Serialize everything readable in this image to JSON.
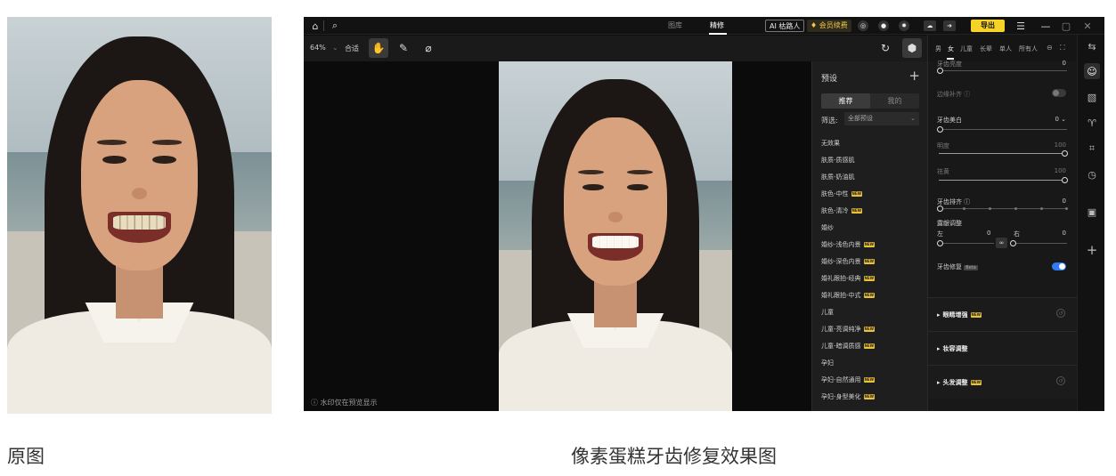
{
  "captions": {
    "left": "原图",
    "right": "像素蛋糕牙齿修复效果图"
  },
  "topbar": {
    "tabs": [
      "图库",
      "精修"
    ],
    "active_tab": "精修",
    "ai_label": "AI 枯路人",
    "member_label": "会员续费",
    "export_label": "导出",
    "icons": [
      "home-icon",
      "search-icon",
      "headset-icon",
      "user-icon",
      "settings-icon",
      "cloud-icon",
      "arrow-icon",
      "menu-icon",
      "minimize-icon",
      "maximize-icon",
      "close-icon"
    ],
    "accent": "#f5d427"
  },
  "toolbar": {
    "zoom": "64%",
    "fit_label": "合适",
    "icons": [
      "hand-icon",
      "brush-icon",
      "eraser-icon",
      "rotate-icon",
      "cube-icon"
    ]
  },
  "canvas": {
    "watermark_note": "水印仅在预览显示"
  },
  "preset_panel": {
    "title": "预设",
    "segments": [
      "推荐",
      "我的"
    ],
    "active_segment": "推荐",
    "filter_label": "筛选:",
    "filter_value": "全部预设",
    "items": [
      {
        "label": "无效果",
        "new": false
      },
      {
        "label": "肤质-质感肌",
        "new": false
      },
      {
        "label": "肤质-奶油肌",
        "new": false
      },
      {
        "label": "肤色-中性",
        "new": true
      },
      {
        "label": "肤色-清冷",
        "new": true
      },
      {
        "label": "婚纱",
        "new": false
      },
      {
        "label": "婚纱-浅色内景",
        "new": true
      },
      {
        "label": "婚纱-深色内景",
        "new": true
      },
      {
        "label": "婚礼跟拍-经典",
        "new": true
      },
      {
        "label": "婚礼跟拍-中式",
        "new": true
      },
      {
        "label": "儿童",
        "new": false
      },
      {
        "label": "儿童-亮调纯净",
        "new": true
      },
      {
        "label": "儿童-暗调质感",
        "new": true
      },
      {
        "label": "孕妇",
        "new": false
      },
      {
        "label": "孕妇-自然通用",
        "new": true
      },
      {
        "label": "孕妇-身型美化",
        "new": true
      }
    ],
    "new_badge": "NEW"
  },
  "settings": {
    "gender_tabs": [
      "男",
      "女",
      "儿童",
      "长辈",
      "单人",
      "所有人"
    ],
    "active_gender": "女",
    "top_partial_label": "牙齿亮度",
    "top_partial_value": "0",
    "edge_label": "边缘补齐",
    "whitening": {
      "label": "牙齿美白",
      "value": "0"
    },
    "brightness": {
      "label": "明度",
      "value": "100"
    },
    "remove_yellow": {
      "label": "祛黄",
      "value": "100"
    },
    "align": {
      "label": "牙齿排齐",
      "value": "0"
    },
    "gum": {
      "label": "露龈调整",
      "left_label": "左",
      "left_value": "0",
      "right_label": "右",
      "right_value": "0"
    },
    "repair": {
      "label": "牙齿修复",
      "badge": "Beta",
      "enabled": true
    },
    "sections": [
      {
        "title": "眼睛增强",
        "new": true
      },
      {
        "title": "妆容调整",
        "new": false
      },
      {
        "title": "头发调整",
        "new": true
      }
    ],
    "toggle_color": "#2f7cf6"
  },
  "rail": {
    "icons": [
      "face-icon",
      "image-icon",
      "shirt-icon",
      "crop-icon",
      "clock-icon",
      "frame-icon",
      "plus-icon"
    ]
  }
}
